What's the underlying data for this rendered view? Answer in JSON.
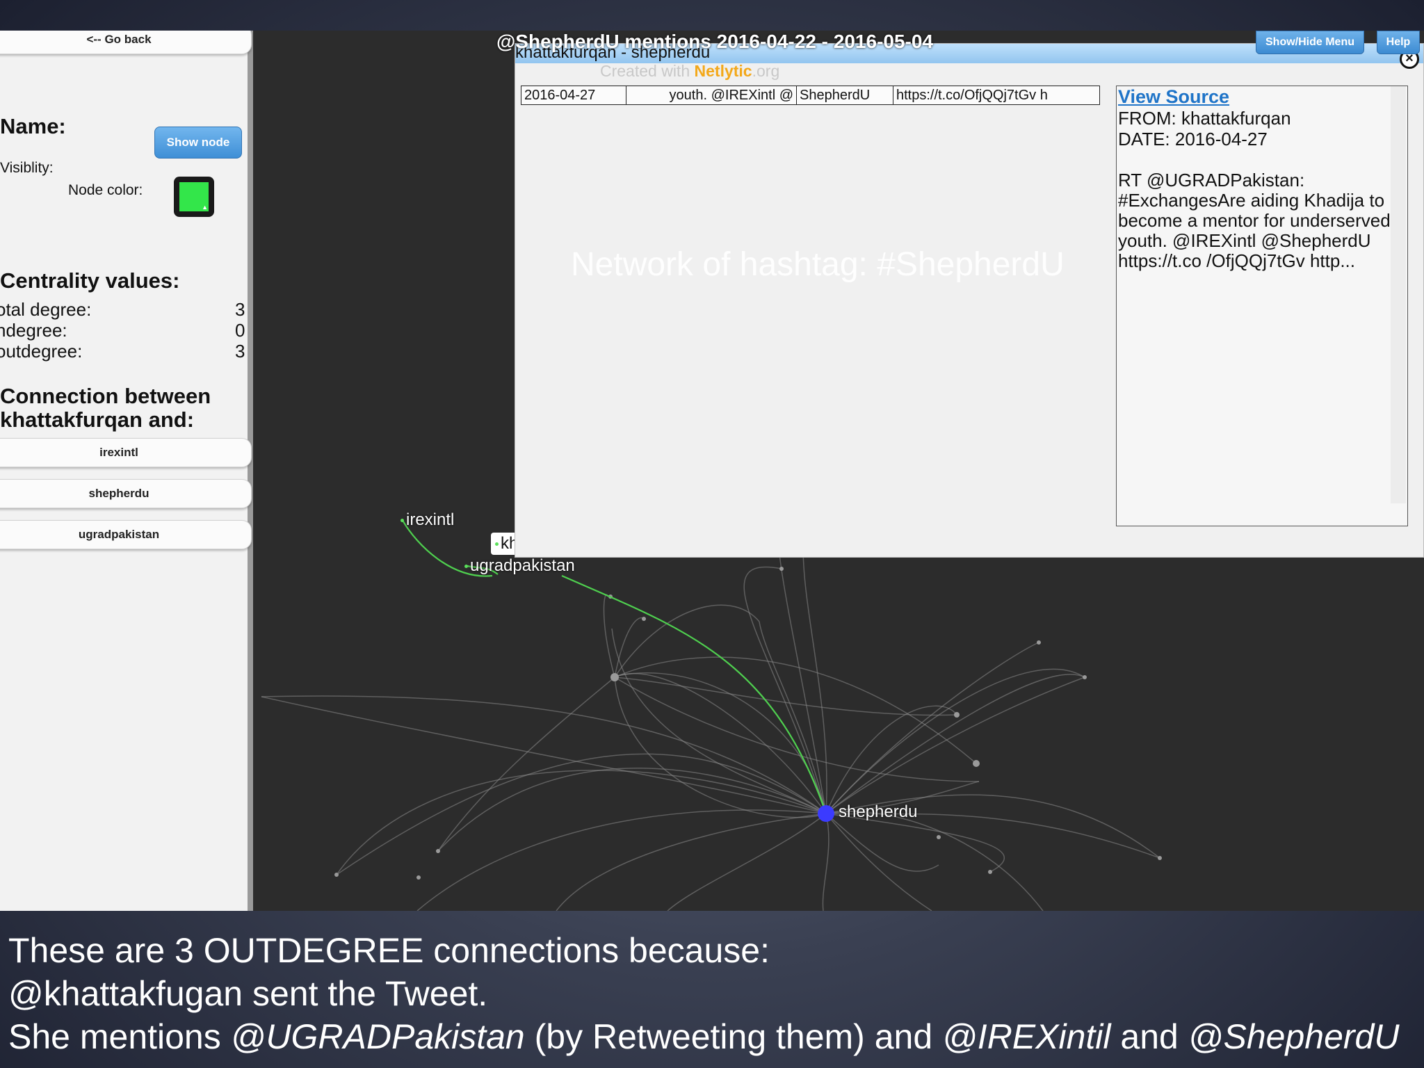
{
  "sidebar": {
    "go_back": "<-- Go back",
    "name_label": "Name:",
    "visibility_label": "Visiblity:",
    "show_node_button": "Show node",
    "node_color_label": "Node color:",
    "node_color": "#33e64a",
    "centrality_heading": "Centrality values:",
    "total_degree_label": "otal degree:",
    "total_degree_value": "3",
    "indegree_label": "ndegree:",
    "indegree_value": "0",
    "outdegree_label": "outdegree:",
    "outdegree_value": "3",
    "connection_heading_line1": "Connection between",
    "connection_heading_line2": "khattakfurqan and:",
    "connections": [
      "irexintl",
      "shepherdu",
      "ugradpakistan"
    ]
  },
  "graph": {
    "title": "@ShepherdU mentions 2016-04-22 - 2016-05-04",
    "show_hide_menu": "Show/Hide Menu",
    "help": "Help",
    "labels": {
      "irexintl": "irexintl",
      "khattakfurqan": "khattakfurqan",
      "ugradpakistan": "ugradpakistan",
      "shepherdu": "shepherdu"
    },
    "edge_highlight_color": "#4fd04f",
    "hub_color": "#3b3bff"
  },
  "popup": {
    "title": "khattakfurqan - shepherdu",
    "created_prefix": "Created with ",
    "created_brand": "Netlytic",
    "created_suffix": ".org",
    "table_row": [
      "2016-04-27",
      "youth. @IREXintl @",
      "ShepherdU",
      "https://t.co/OfjQQj7tGv h"
    ],
    "watermark": "Network of hashtag: #ShepherdU",
    "detail": {
      "view_source": "View Source",
      "from": "FROM: khattakfurqan",
      "date": "DATE: 2016-04-27",
      "tweet": "RT @UGRADPakistan: #ExchangesAre aiding Khadija to become a mentor for underserved youth. @IREXintl @ShepherdU https://t.co /OfjQQj7tGv http..."
    }
  },
  "caption": {
    "line1": "These are 3 OUTDEGREE connections because:",
    "line2": "@khattakfugan sent the Tweet.",
    "line3_a": "She mentions ",
    "line3_b": "@UGRADPakistan",
    "line3_c": " (by Retweeting them) and ",
    "line3_d": "@IREXintil",
    "line3_e": " and ",
    "line3_f": "@ShepherdU"
  }
}
